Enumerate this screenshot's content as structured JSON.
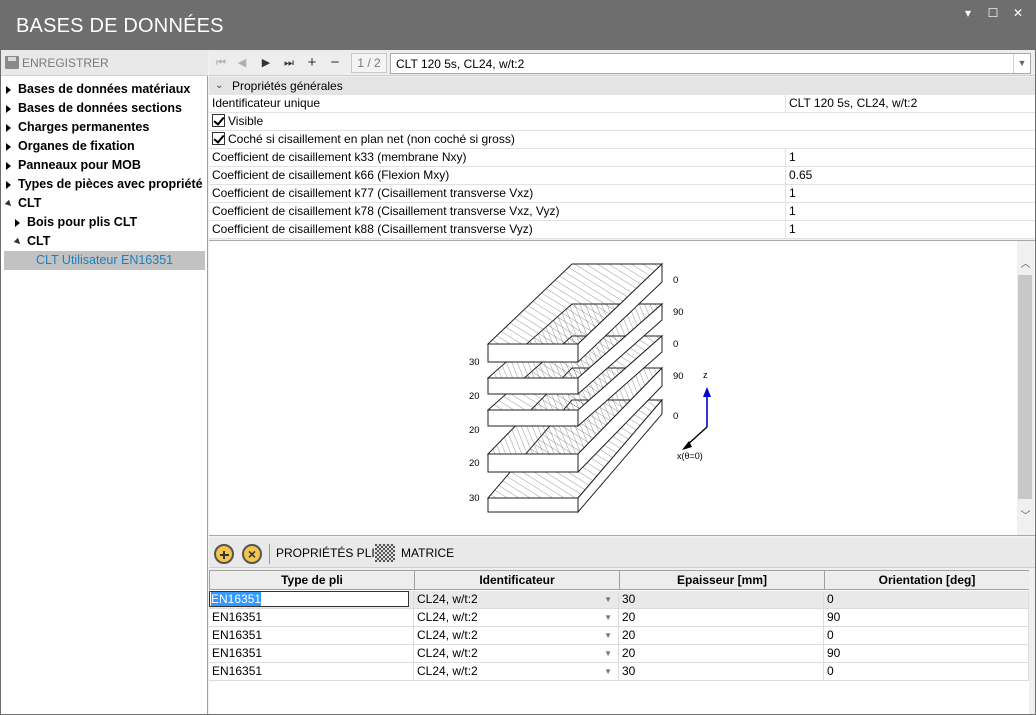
{
  "window": {
    "title": "BASES DE DONNÉES",
    "controls": {
      "minimize": "▾",
      "maximize": "☐",
      "close": "✕"
    }
  },
  "left": {
    "save_label": "ENREGISTRER",
    "tree": [
      {
        "label": "Bases de données matériaux"
      },
      {
        "label": "Bases de données sections"
      },
      {
        "label": "Charges permanentes"
      },
      {
        "label": "Organes de fixation"
      },
      {
        "label": "Panneaux pour MOB"
      },
      {
        "label": "Types de pièces avec propriété"
      },
      {
        "label": "CLT"
      },
      {
        "label": "Bois pour plis CLT"
      },
      {
        "label": "CLT"
      },
      {
        "label": "CLT Utilisateur EN16351"
      }
    ]
  },
  "nav": {
    "page": "1 / 2",
    "record": "CLT 120 5s, CL24, w/t:2"
  },
  "props": {
    "header": "Propriétés générales",
    "rows": [
      {
        "name": "Identificateur unique",
        "value": "CLT 120 5s, CL24, w/t:2"
      },
      {
        "name": "Visible",
        "value": ""
      },
      {
        "name": "Coché si cisaillement en plan net (non coché si gross)",
        "value": ""
      },
      {
        "name": "Coefficient de cisaillement k33 (membrane Nxy)",
        "value": "1"
      },
      {
        "name": "Coefficient de cisaillement k66 (Flexion Mxy)",
        "value": "0.65"
      },
      {
        "name": "Coefficient de cisaillement k77 (Cisaillement transverse Vxz)",
        "value": "1"
      },
      {
        "name": "Coefficient de cisaillement k78 (Cisaillement transverse Vxz, Vyz)",
        "value": "1"
      },
      {
        "name": "Coefficient de cisaillement k88 (Cisaillement transverse Vyz)",
        "value": "1"
      }
    ]
  },
  "drawing": {
    "orientations": [
      "0",
      "90",
      "0",
      "90",
      "0"
    ],
    "thicknesses": [
      "30",
      "20",
      "20",
      "20",
      "30"
    ],
    "axis_z": "z",
    "axis_x": "x(θ=0)",
    "axis_color": "#0000cc"
  },
  "plies_toolbar": {
    "props_label": "PROPRIÉTÉS PLIS",
    "matrix_label": "MATRICE"
  },
  "grid": {
    "headers": [
      "Type de pli",
      "Identificateur",
      "Epaisseur [mm]",
      "Orientation [deg]"
    ],
    "rows": [
      [
        "EN16351",
        "CL24, w/t:2",
        "30",
        "0"
      ],
      [
        "EN16351",
        "CL24, w/t:2",
        "20",
        "90"
      ],
      [
        "EN16351",
        "CL24, w/t:2",
        "20",
        "0"
      ],
      [
        "EN16351",
        "CL24, w/t:2",
        "20",
        "90"
      ],
      [
        "EN16351",
        "CL24, w/t:2",
        "30",
        "0"
      ]
    ]
  }
}
